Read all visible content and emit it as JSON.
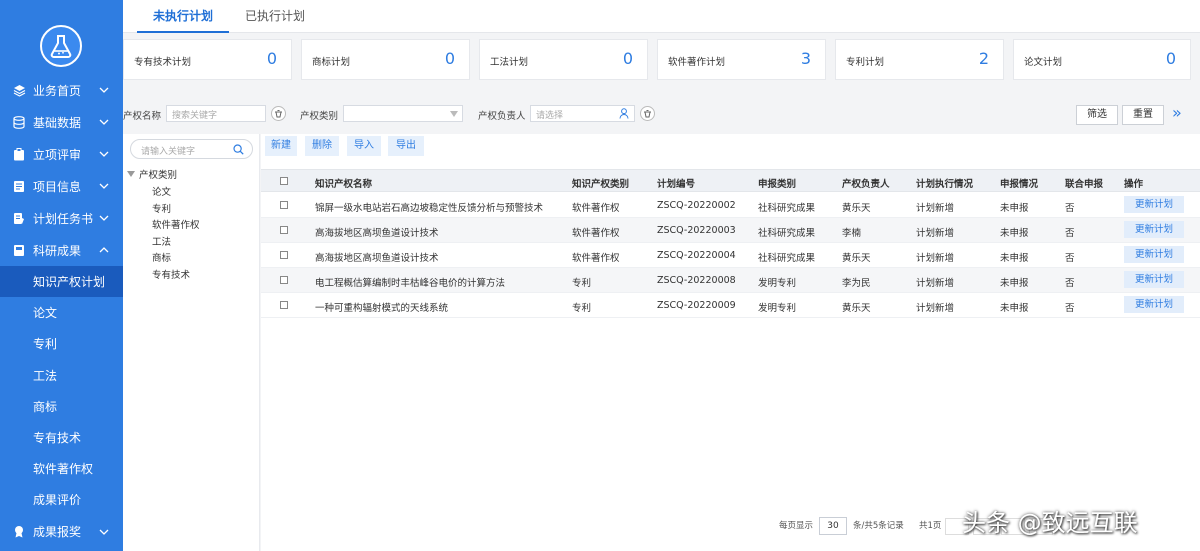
{
  "tabs": {
    "pending": "未执行计划",
    "done": "已执行计划"
  },
  "stats": [
    {
      "label": "专有技术计划",
      "value": "0"
    },
    {
      "label": "商标计划",
      "value": "0"
    },
    {
      "label": "工法计划",
      "value": "0"
    },
    {
      "label": "软件著作计划",
      "value": "3"
    },
    {
      "label": "专利计划",
      "value": "2"
    },
    {
      "label": "论文计划",
      "value": "0"
    }
  ],
  "sidebar": {
    "items": [
      {
        "label": "业务首页"
      },
      {
        "label": "基础数据"
      },
      {
        "label": "立项评审"
      },
      {
        "label": "项目信息"
      },
      {
        "label": "计划任务书"
      },
      {
        "label": "科研成果"
      }
    ],
    "sub": [
      {
        "label": "知识产权计划"
      },
      {
        "label": "论文"
      },
      {
        "label": "专利"
      },
      {
        "label": "工法"
      },
      {
        "label": "商标"
      },
      {
        "label": "专有技术"
      },
      {
        "label": "软件著作权"
      },
      {
        "label": "成果评价"
      }
    ],
    "last": {
      "label": "成果报奖"
    }
  },
  "filter": {
    "name_label": "产权名称",
    "name_placeholder": "搜索关键字",
    "type_label": "产权类别",
    "owner_label": "产权负责人",
    "owner_placeholder": "请选择",
    "filter_btn": "筛选",
    "reset_btn": "重置",
    "more": "»"
  },
  "tree": {
    "search_placeholder": "请输入关键字",
    "root": "产权类别",
    "nodes": [
      "论文",
      "专利",
      "软件著作权",
      "工法",
      "商标",
      "专有技术"
    ]
  },
  "actions": {
    "new": "新建",
    "delete": "删除",
    "import": "导入",
    "export": "导出"
  },
  "table": {
    "headers": [
      "知识产权名称",
      "知识产权类别",
      "计划编号",
      "申报类别",
      "产权负责人",
      "计划执行情况",
      "申报情况",
      "联合申报",
      "操作"
    ],
    "rows": [
      {
        "name": "锦屏一级水电站岩石高边坡稳定性反馈分析与预警技术",
        "type": "软件著作权",
        "code": "ZSCQ-20220002",
        "apply": "社科研究成果",
        "owner": "黄乐天",
        "exec": "计划新增",
        "status": "未申报",
        "joint": "否",
        "op": "更新计划"
      },
      {
        "name": "高海拔地区高坝鱼道设计技术",
        "type": "软件著作权",
        "code": "ZSCQ-20220003",
        "apply": "社科研究成果",
        "owner": "李楠",
        "exec": "计划新增",
        "status": "未申报",
        "joint": "否",
        "op": "更新计划"
      },
      {
        "name": "高海拔地区高坝鱼道设计技术",
        "type": "软件著作权",
        "code": "ZSCQ-20220004",
        "apply": "社科研究成果",
        "owner": "黄乐天",
        "exec": "计划新增",
        "status": "未申报",
        "joint": "否",
        "op": "更新计划"
      },
      {
        "name": "电工程概估算编制时丰枯峰谷电价的计算方法",
        "type": "专利",
        "code": "ZSCQ-20220008",
        "apply": "发明专利",
        "owner": "李为民",
        "exec": "计划新增",
        "status": "未申报",
        "joint": "否",
        "op": "更新计划"
      },
      {
        "name": "一种可重构辐射模式的天线系统",
        "type": "专利",
        "code": "ZSCQ-20220009",
        "apply": "发明专利",
        "owner": "黄乐天",
        "exec": "计划新增",
        "status": "未申报",
        "joint": "否",
        "op": "更新计划"
      }
    ]
  },
  "pager": {
    "per_page_label": "每页显示",
    "per_page": "30",
    "total": "条/共5条记录",
    "pages": "共1页"
  },
  "watermark": "头条 @致远互联",
  "colors": {
    "primary": "#2f7de1",
    "sidebar": "#2f7de1",
    "active": "#1a5bbd"
  }
}
